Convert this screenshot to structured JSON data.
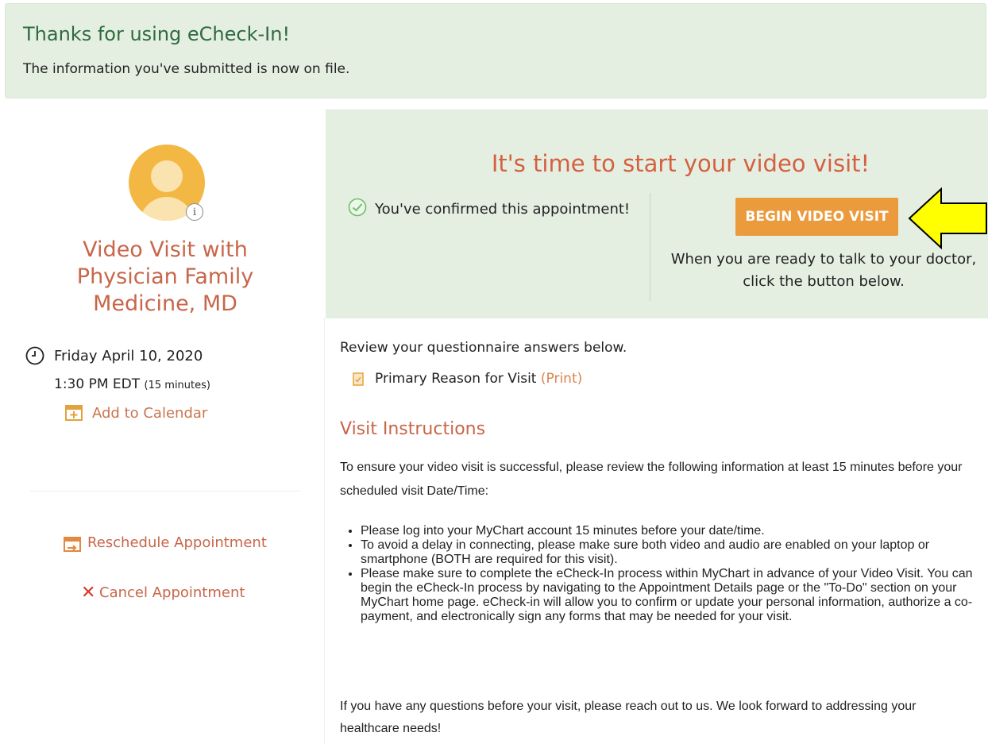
{
  "banner": {
    "title": "Thanks for using eCheck-In!",
    "subtitle": "The information you've submitted is now on file."
  },
  "appointment": {
    "avatar_info": "i",
    "title_lines": [
      "Video Visit with",
      "Physician Family",
      "Medicine, MD"
    ],
    "date": "Friday April 10, 2020",
    "time": "1:30 PM EDT",
    "duration": "(15 minutes)",
    "add_to_calendar": "Add to Calendar",
    "reschedule": "Reschedule Appointment",
    "cancel": "Cancel Appointment"
  },
  "video_panel": {
    "title": "It's time to start your video visit!",
    "confirmed": "You've confirmed this appointment!",
    "begin_button": "BEGIN VIDEO VISIT",
    "ready_text": "When you are ready to talk to your doctor, click the button below."
  },
  "questionnaire": {
    "review_text": "Review your questionnaire answers below.",
    "reason_label": "Primary Reason for Visit",
    "print_link": "(Print)"
  },
  "instructions": {
    "title": "Visit Instructions",
    "intro": "To ensure your video visit is successful, please review the following information at least 15 minutes before your scheduled visit Date/Time:",
    "bullets": [
      "Please log into your MyChart account 15 minutes before your date/time.",
      "To avoid a delay in connecting, please make sure both video and audio are enabled on your laptop or smartphone (BOTH are required for this visit).",
      "Please make sure to complete the eCheck-In process within MyChart in advance of your Video Visit. You can begin the eCheck-In process by navigating to the Appointment Details page or the \"To-Do\" section on your MyChart home page. eCheck-in will allow you to confirm or update your personal information, authorize a co-payment, and electronically sign any forms that may be needed for your visit."
    ],
    "closing": "If you have any questions before your visit, please reach out to us. We look forward to addressing your healthcare needs!"
  },
  "colors": {
    "banner_bg": "#e4efe2",
    "accent_title": "#c8664a",
    "button_bg": "#eb9a3c",
    "arrow_fill": "#ffff00"
  }
}
